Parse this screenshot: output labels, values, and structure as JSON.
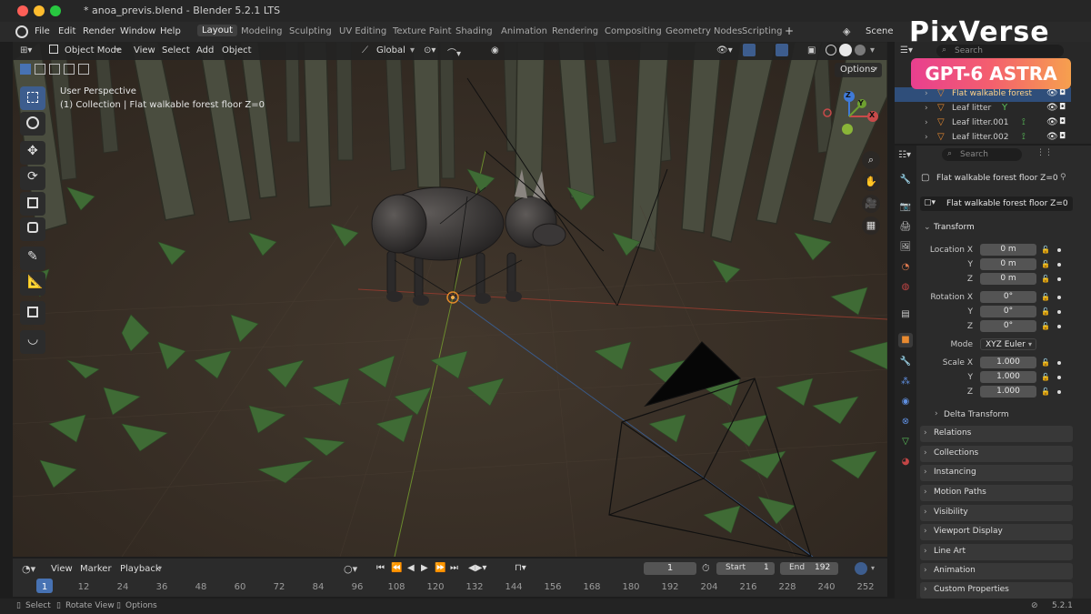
{
  "window": {
    "title": "* anoa_previs.blend - Blender 5.2.1 LTS"
  },
  "menu": [
    "File",
    "Edit",
    "Render",
    "Window",
    "Help"
  ],
  "workspaces": [
    "Layout",
    "Modeling",
    "Sculpting",
    "UV Editing",
    "Texture Paint",
    "Shading",
    "Animation",
    "Rendering",
    "Compositing",
    "Geometry Nodes",
    "Scripting"
  ],
  "active_workspace": "Layout",
  "scene_label": "Scene",
  "viewport": {
    "mode": "Object Mode",
    "menus": [
      "View",
      "Select",
      "Add",
      "Object"
    ],
    "orientation": "Global",
    "options_label": "Options",
    "overlay_line1": "User Perspective",
    "overlay_line2": "(1) Collection | Flat walkable forest floor Z=0",
    "gizmo_axes": {
      "x": "X",
      "y": "Y",
      "z": "Z"
    }
  },
  "timeline": {
    "menus": [
      "View",
      "Marker",
      "Playback"
    ],
    "current_frame": "1",
    "start_label": "Start",
    "start": "1",
    "end_label": "End",
    "end": "192",
    "ticks": [
      "1",
      "12",
      "24",
      "36",
      "48",
      "60",
      "72",
      "84",
      "96",
      "108",
      "120",
      "132",
      "144",
      "156",
      "168",
      "180",
      "192",
      "204",
      "216",
      "228",
      "240",
      "252"
    ]
  },
  "status": {
    "select": "Select",
    "rotate": "Rotate View",
    "options": "Options",
    "version": "5.2.1"
  },
  "outliner": {
    "search_placeholder": "Search",
    "items": [
      "Flat walkable forest",
      "Leaf litter",
      "Leaf litter.001",
      "Leaf litter.002"
    ],
    "selected_color": "#2f4e7a"
  },
  "properties": {
    "search_placeholder": "Search",
    "object_name": "Flat walkable forest floor Z=0",
    "data_name": "Flat walkable forest floor Z=0",
    "transform_title": "Transform",
    "location": {
      "label": "Location X",
      "x": "0 m",
      "y": "0 m",
      "z": "0 m"
    },
    "rotation": {
      "label": "Rotation X",
      "x": "0°",
      "y": "0°",
      "z": "0°"
    },
    "mode_label": "Mode",
    "mode_value": "XYZ Euler",
    "scale": {
      "label": "Scale X",
      "x": "1.000",
      "y": "1.000",
      "z": "1.000"
    },
    "axis_y": "Y",
    "axis_z": "Z",
    "delta": "Delta Transform",
    "panels": [
      "Relations",
      "Collections",
      "Instancing",
      "Motion Paths",
      "Visibility",
      "Viewport Display",
      "Line Art",
      "Animation",
      "Custom Properties"
    ]
  },
  "watermark": {
    "brand": "PixVerse",
    "badge": "GPT-6 ASTRA"
  },
  "colors": {
    "accent": "#4772b3",
    "ground": "#3a3128",
    "tree": "#474a3c",
    "leaf": "#3f6b35"
  }
}
